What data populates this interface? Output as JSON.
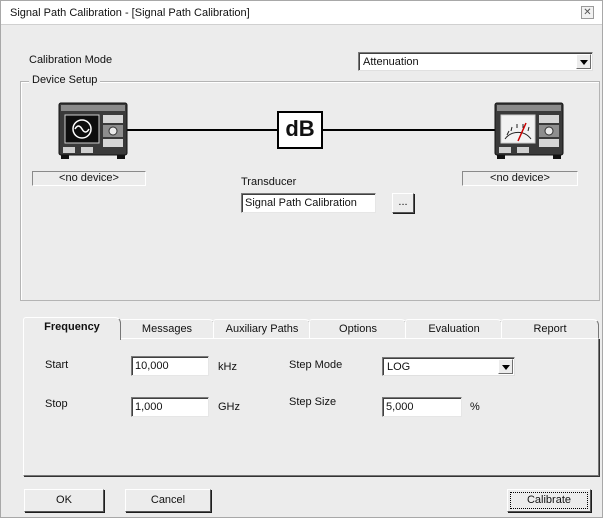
{
  "window": {
    "title": "Signal Path Calibration - [Signal Path Calibration]"
  },
  "calibration_mode": {
    "label": "Calibration Mode",
    "value": "Attenuation"
  },
  "device_setup": {
    "legend": "Device Setup",
    "source_device": "<no device>",
    "receiver_device": "<no device>",
    "transducer_block": "dB",
    "transducer_label": "Transducer",
    "transducer_value": "Signal Path Calibration",
    "browse_label": "..."
  },
  "tabs": [
    {
      "label": "Frequency"
    },
    {
      "label": "Messages"
    },
    {
      "label": "Auxiliary Paths"
    },
    {
      "label": "Options"
    },
    {
      "label": "Evaluation"
    },
    {
      "label": "Report"
    }
  ],
  "active_tab": "Frequency",
  "frequency": {
    "start": {
      "label": "Start",
      "value": "10,000",
      "unit": "kHz"
    },
    "stop": {
      "label": "Stop",
      "value": "1,000",
      "unit": "GHz"
    },
    "step_mode": {
      "label": "Step Mode",
      "value": "LOG"
    },
    "step_size": {
      "label": "Step Size",
      "value": "5,000",
      "unit": "%"
    }
  },
  "buttons": {
    "ok": "OK",
    "cancel": "Cancel",
    "calibrate": "Calibrate"
  }
}
